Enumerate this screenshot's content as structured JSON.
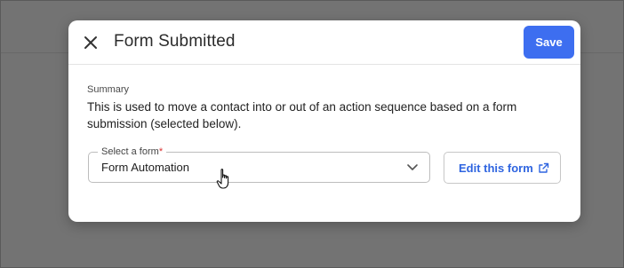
{
  "modal": {
    "title": "Form Submitted",
    "save_label": "Save"
  },
  "summary": {
    "label": "Summary",
    "text": "This is used to move a contact into or out of an action sequence based on a form submission (selected below)."
  },
  "form_select": {
    "label": "Select a form",
    "required_marker": "*",
    "value": "Form Automation"
  },
  "edit_button": {
    "label": "Edit this form"
  },
  "icons": {
    "close": "close-icon",
    "chevron": "chevron-down-icon",
    "external": "external-link-icon",
    "cursor": "hand-pointer-cursor"
  },
  "colors": {
    "accent": "#3d6ef0",
    "link": "#2f65e0",
    "required": "#d93030",
    "backdrop": "#737373"
  }
}
